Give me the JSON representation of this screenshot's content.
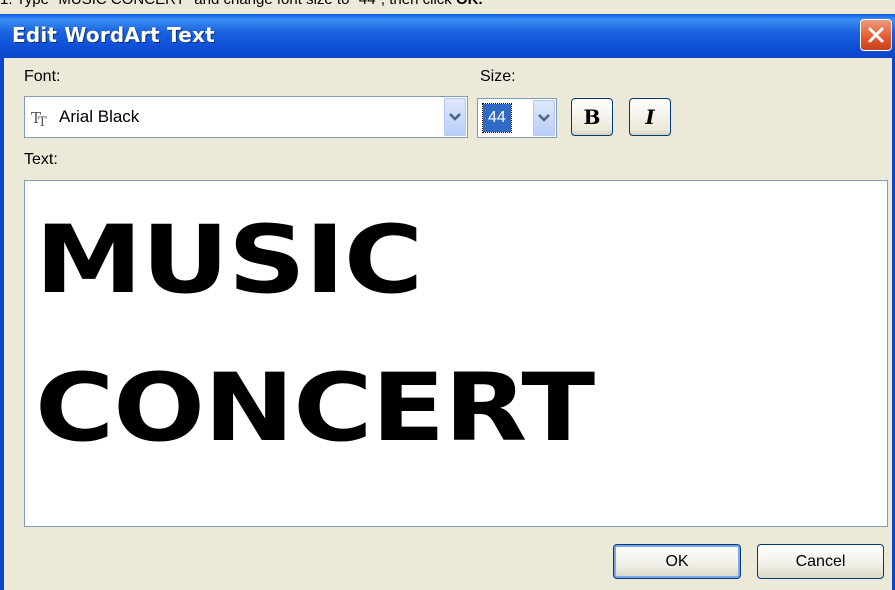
{
  "caption": {
    "text": "1. Type \"MUSIC CONCERT\" and change font size to \"44\", then click ",
    "bold": "OK."
  },
  "dialog": {
    "title": "Edit WordArt Text",
    "font_label": "Font:",
    "font_value": "Arial Black",
    "size_label": "Size:",
    "size_value": "44",
    "bold_label": "B",
    "italic_label": "I",
    "text_label": "Text:",
    "text_lines": [
      "MUSIC",
      "CONCERT"
    ],
    "ok_label": "OK",
    "cancel_label": "Cancel"
  },
  "colors": {
    "titlebar": "#0a46c8",
    "close": "#e3582e",
    "face": "#ece9d8"
  }
}
